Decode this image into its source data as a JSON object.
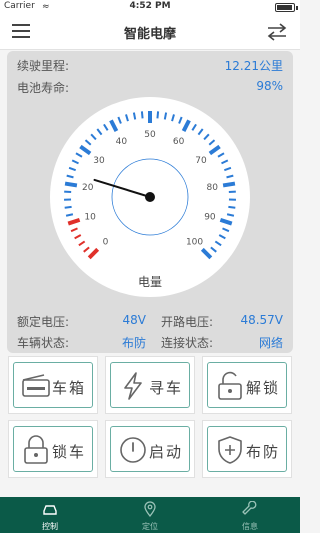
{
  "status_bar": {
    "carrier": "Carrier",
    "time": "4:52 PM"
  },
  "nav": {
    "title": "智能电摩",
    "menu_icon": "menu-icon",
    "swap_icon": "swap-icon"
  },
  "info": {
    "range_label": "续驶里程:",
    "range_value": "12.21公里",
    "battery_label": "电池寿命:",
    "battery_value": "98%"
  },
  "gauge": {
    "label": "电量",
    "min": 0,
    "max": 100,
    "value": 23,
    "ticks": [
      "0",
      "10",
      "20",
      "30",
      "40",
      "50",
      "60",
      "70",
      "80",
      "90",
      "100"
    ],
    "accent": "#2b7bd6",
    "warn": "#e0302a"
  },
  "details": {
    "rated_voltage_label": "额定电压:",
    "rated_voltage_value": "48V",
    "open_voltage_label": "开路电压:",
    "open_voltage_value": "48.57V",
    "vehicle_state_label": "车辆状态:",
    "vehicle_state_value": "布防",
    "connection_label": "连接状态:",
    "connection_value": "网络"
  },
  "buttons": [
    {
      "label": "车箱",
      "icon": "trunk-icon"
    },
    {
      "label": "寻车",
      "icon": "lightning-icon"
    },
    {
      "label": "解锁",
      "icon": "unlock-icon"
    },
    {
      "label": "锁车",
      "icon": "lock-icon"
    },
    {
      "label": "启动",
      "icon": "power-icon"
    },
    {
      "label": "布防",
      "icon": "shield-plus-icon"
    }
  ],
  "tabs": [
    {
      "label": "控制",
      "icon": "car-icon"
    },
    {
      "label": "定位",
      "icon": "location-icon"
    },
    {
      "label": "信息",
      "icon": "wrench-icon"
    }
  ]
}
